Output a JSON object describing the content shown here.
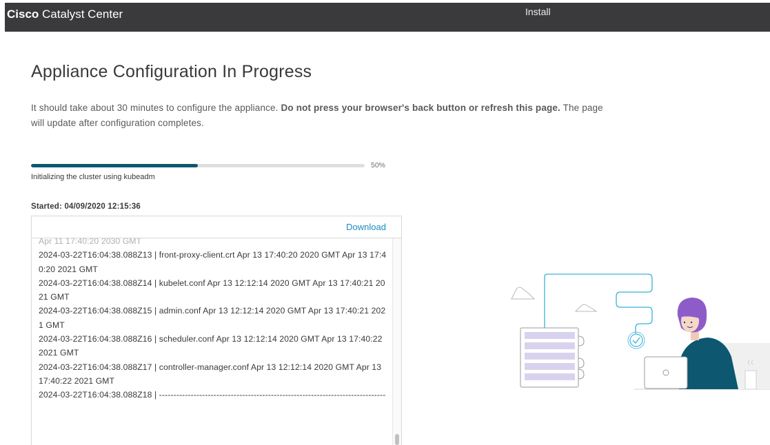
{
  "header": {
    "brand_bold": "Cisco",
    "brand_product": "Catalyst Center",
    "section_title": "Install"
  },
  "main": {
    "title": "Appliance Configuration In Progress",
    "desc_part1": "It should take about 30 minutes to configure the appliance. ",
    "desc_bold": "Do not press your browser's back button or refresh this page.",
    "desc_part2": " The page will update after configuration completes."
  },
  "progress": {
    "percent": 50,
    "percent_label": "50%",
    "step": "Initializing the cluster using kubeadm"
  },
  "started": "Started: 04/09/2020 12:15:36",
  "log": {
    "download_label": "Download",
    "lines": [
      {
        "text": "Apr 11 17:40:20 2030 GMT",
        "faded": true
      },
      {
        "text": "2024-03-22T16:04:38.088Z13 | front-proxy-client.crt Apr 13 17:40:20 2020 GMT Apr 13 17:40:20 2021 GMT",
        "faded": false
      },
      {
        "text": "2024-03-22T16:04:38.088Z14 | kubelet.conf Apr 13 12:12:14 2020 GMT Apr 13 17:40:21 2021 GMT",
        "faded": false
      },
      {
        "text": "2024-03-22T16:04:38.088Z15 | admin.conf Apr 13 12:12:14 2020 GMT Apr 13 17:40:21 2021 GMT",
        "faded": false
      },
      {
        "text": "2024-03-22T16:04:38.088Z16 | scheduler.conf Apr 13 12:12:14 2020 GMT Apr 13 17:40:22 2021 GMT",
        "faded": false
      },
      {
        "text": "2024-03-22T16:04:38.088Z17 | controller-manager.conf Apr 13 12:12:14 2020 GMT Apr 13 17:40:22 2021 GMT",
        "faded": false
      },
      {
        "text": "2024-03-22T16:04:38.088Z18 | -------------------------------------------------------------------------------",
        "faded": false
      }
    ]
  },
  "colors": {
    "topbar": "#3a3a3c",
    "progress_fill": "#0d5770",
    "link": "#1a8bbf",
    "illustration_accent": "#38b2d8",
    "person_hair": "#8e5cc9",
    "server_slot": "#d9d2ef"
  },
  "icons": {
    "illustration": "person-at-laptop-with-server-illustration"
  }
}
